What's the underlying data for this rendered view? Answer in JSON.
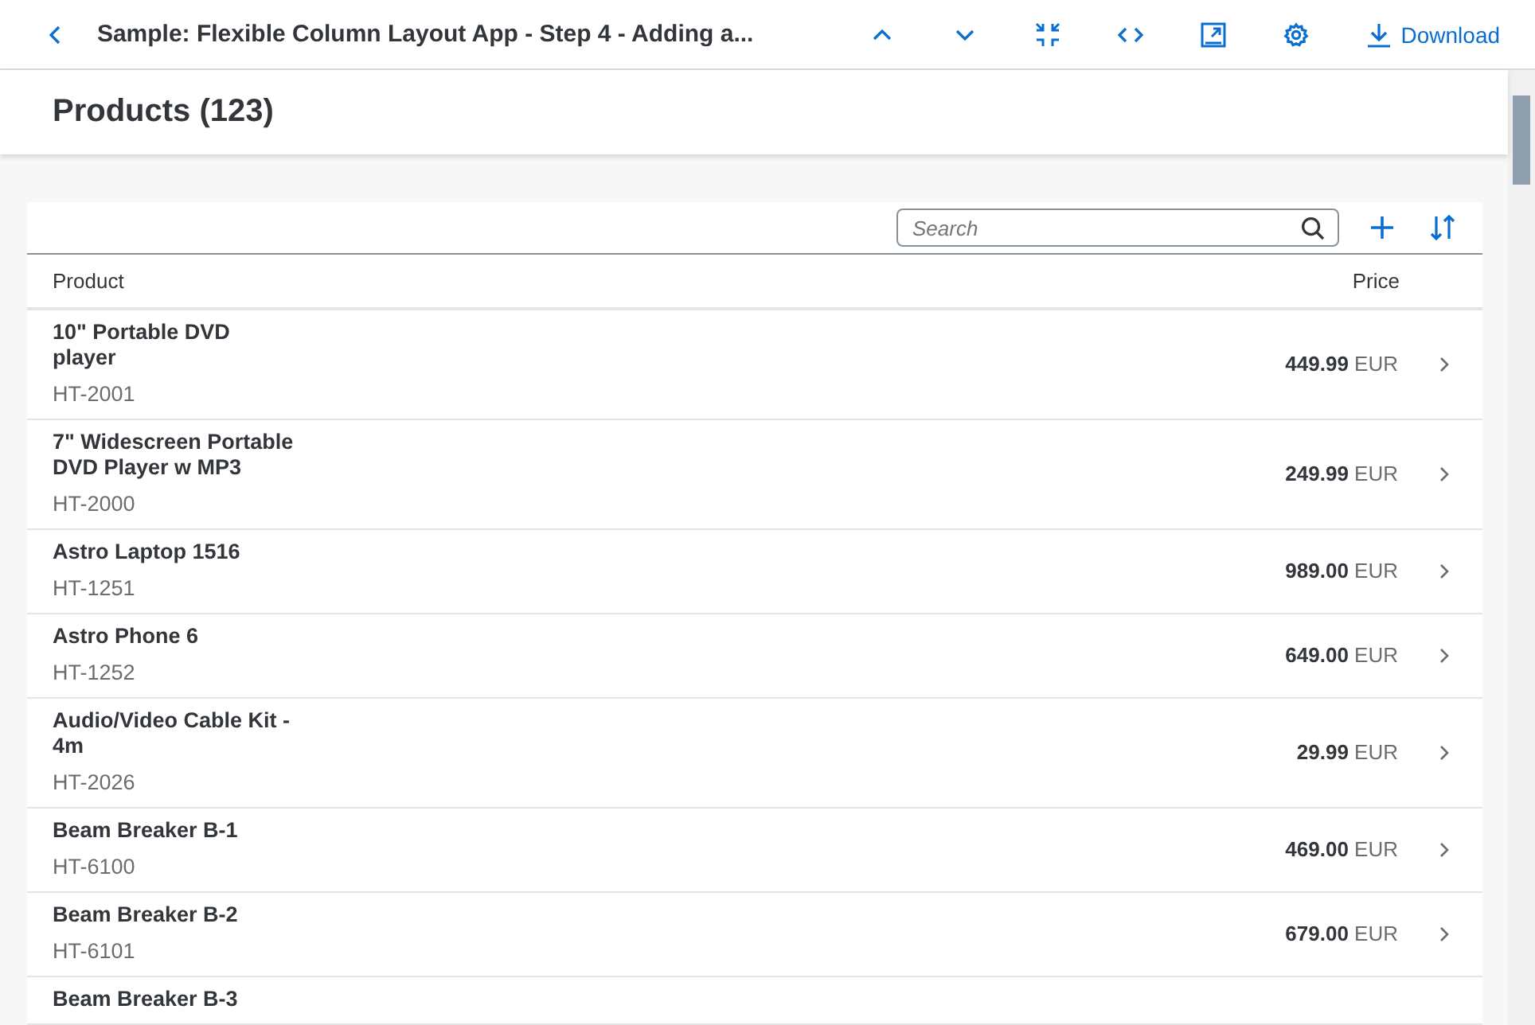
{
  "toolbar": {
    "title": "Sample: Flexible Column Layout App - Step 4 - Adding a...",
    "download": "Download"
  },
  "header": {
    "title": "Products (123)"
  },
  "search": {
    "placeholder": "Search"
  },
  "table": {
    "columns": [
      "Product",
      "Price"
    ],
    "rows": [
      {
        "name": "10\" Portable DVD player",
        "id": "HT-2001",
        "price": "449.99",
        "currency": "EUR"
      },
      {
        "name": "7\" Widescreen Portable DVD Player w MP3",
        "id": "HT-2000",
        "price": "249.99",
        "currency": "EUR"
      },
      {
        "name": "Astro Laptop 1516",
        "id": "HT-1251",
        "price": "989.00",
        "currency": "EUR"
      },
      {
        "name": "Astro Phone 6",
        "id": "HT-1252",
        "price": "649.00",
        "currency": "EUR"
      },
      {
        "name": "Audio/Video Cable Kit - 4m",
        "id": "HT-2026",
        "price": "29.99",
        "currency": "EUR"
      },
      {
        "name": "Beam Breaker B-1",
        "id": "HT-6100",
        "price": "469.00",
        "currency": "EUR"
      },
      {
        "name": "Beam Breaker B-2",
        "id": "HT-6101",
        "price": "679.00",
        "currency": "EUR"
      },
      {
        "name": "Beam Breaker B-3"
      }
    ]
  }
}
